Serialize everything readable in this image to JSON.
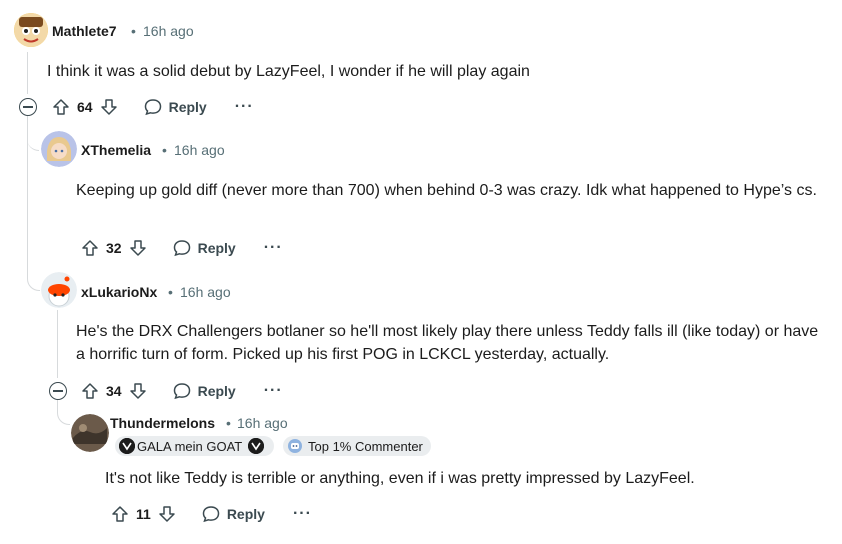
{
  "comments": [
    {
      "username": "Mathlete7",
      "time": "16h ago",
      "body": "I think it was a solid debut by LazyFeel, I wonder if he will play again",
      "votes": "64",
      "reply_label": "Reply",
      "more_label": "···"
    },
    {
      "username": "XThemelia",
      "time": "16h ago",
      "body": "Keeping up gold diff (never more than 700) when behind 0-3 was crazy. Idk what happened to Hype’s cs.",
      "votes": "32",
      "reply_label": "Reply",
      "more_label": "···"
    },
    {
      "username": "xLukarioNx",
      "time": "16h ago",
      "body": "He's the DRX Challengers botlaner so he'll most likely play there unless Teddy falls ill (like today) or have a horrific turn of form. Picked up his first POG in LCKCL yesterday, actually.",
      "votes": "34",
      "reply_label": "Reply",
      "more_label": "···"
    },
    {
      "username": "Thundermelons",
      "time": "16h ago",
      "flair": "GALA mein GOAT",
      "badge": "Top 1% Commenter",
      "body": "It's not like Teddy is terrible or anything, even if i was pretty impressed by LazyFeel.",
      "votes": "11",
      "reply_label": "Reply",
      "more_label": "···"
    }
  ],
  "separator": "•",
  "colors": {
    "meta": "#576f76",
    "thread": "#d7dadc",
    "flair_bg": "#eaedef"
  }
}
